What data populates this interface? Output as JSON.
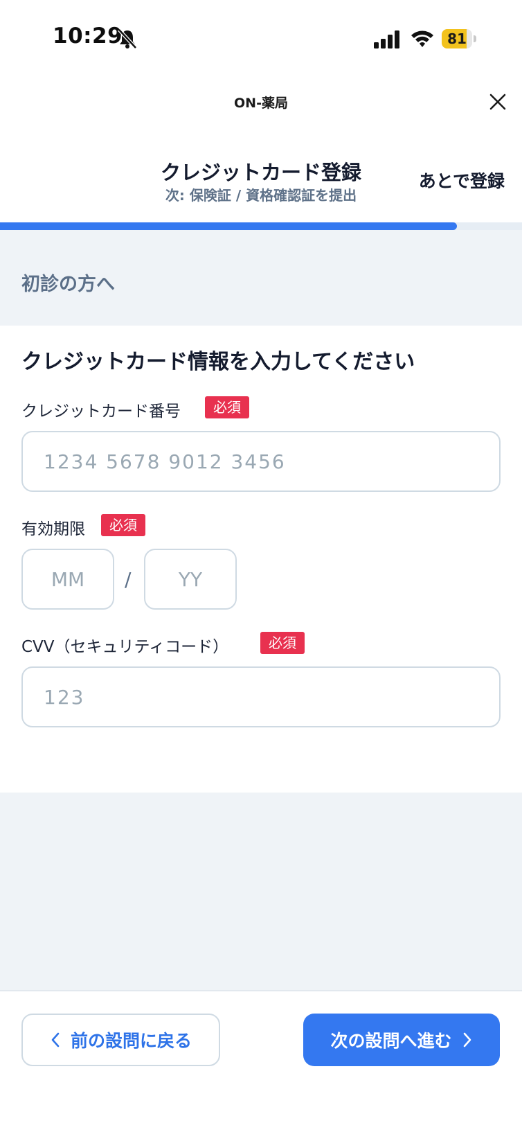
{
  "status_bar": {
    "time": "10:29",
    "battery": "81",
    "battery_level": 0.81
  },
  "header": {
    "app_title": "ON-薬局",
    "step_title": "クレジットカード登録",
    "step_next": "次: 保険証 / 資格確認証を提出",
    "register_later": "あとで登録",
    "progress": 0.875
  },
  "section": {
    "title": "初診の方へ"
  },
  "form": {
    "heading": "クレジットカード情報を入力してください",
    "required_label": "必須",
    "card_number": {
      "label": "クレジットカード番号",
      "placeholder": "1234 5678 9012 3456"
    },
    "expiry": {
      "label": "有効期限",
      "month_placeholder": "MM",
      "separator": "/",
      "year_placeholder": "YY"
    },
    "cvv": {
      "label": "CVV（セキュリティコード）",
      "placeholder": "123"
    }
  },
  "footer": {
    "back_label": "前の設問に戻る",
    "next_label": "次の設問へ進む"
  },
  "colors": {
    "accent": "#3478f0",
    "required": "#e8314f",
    "band": "#eff3f7"
  }
}
